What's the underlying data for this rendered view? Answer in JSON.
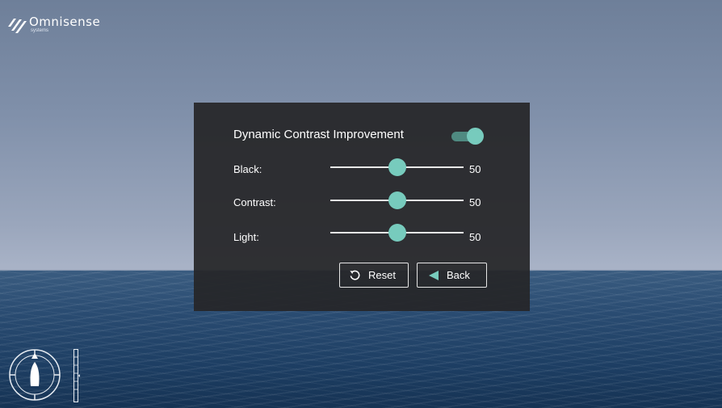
{
  "brand": {
    "name": "Omnisense",
    "sub": "systems",
    "icon": "omnisense-logo-icon"
  },
  "panel": {
    "dci_label": "Dynamic Contrast Improvement",
    "dci_enabled": true,
    "sliders": [
      {
        "label": "Black:",
        "value": "50",
        "level": 0.5
      },
      {
        "label": "Contrast:",
        "value": "50",
        "level": 0.5
      },
      {
        "label": "Light:",
        "value": "50",
        "level": 0.5
      }
    ],
    "reset_label": "Reset",
    "back_label": "Back",
    "reset_icon": "refresh-icon",
    "back_icon": "triangle-left-icon"
  },
  "hud": {
    "compass_icon": "compass-boat-icon",
    "scale_icon": "vertical-scale-icon"
  },
  "colors": {
    "accent": "#77cbbd",
    "toggle_track": "#4f8a81",
    "panel_bg": "#262628"
  }
}
